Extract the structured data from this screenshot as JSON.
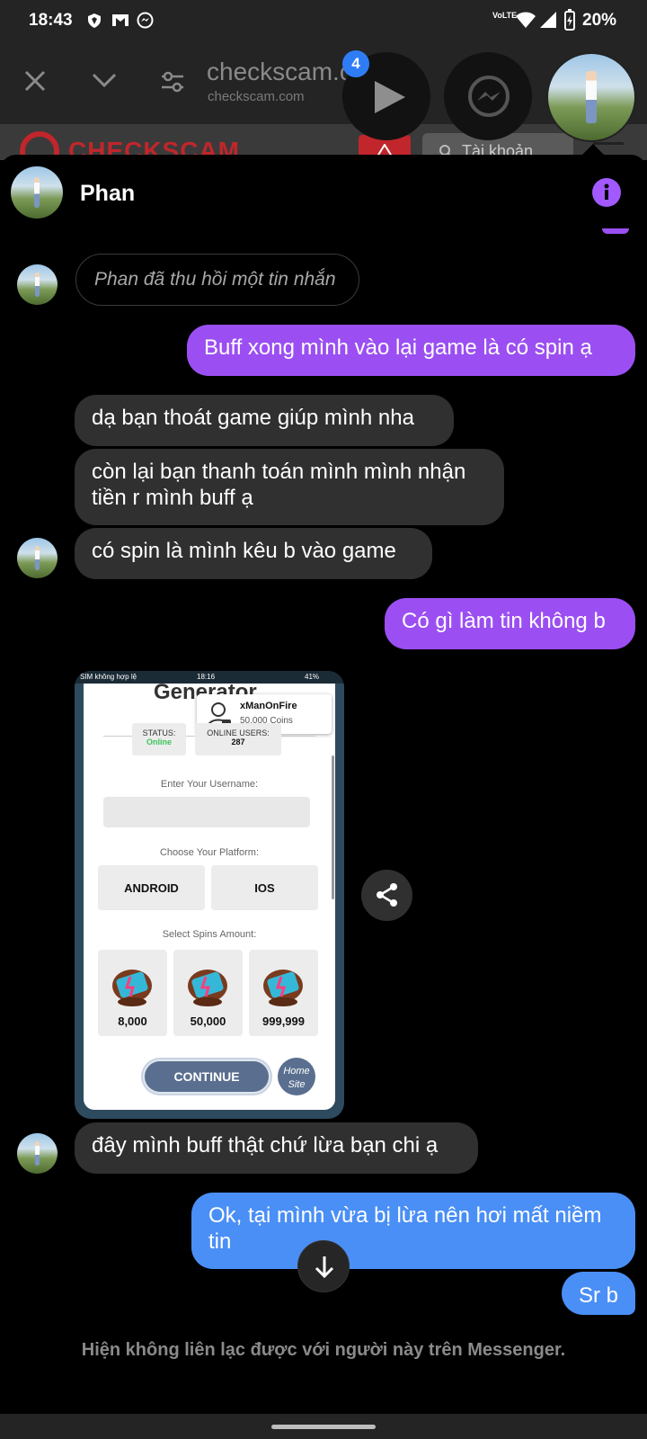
{
  "status_bar": {
    "time": "18:43",
    "network_label": "VoLTE",
    "battery": "20%",
    "icons": [
      "shield-icon",
      "gmail-icon",
      "messenger-icon",
      "wifi-icon",
      "signal-icon",
      "battery-icon"
    ]
  },
  "browser": {
    "title": "checkscam.c",
    "url": "checkscam.com",
    "chat_head_badge": "4"
  },
  "site_peek": {
    "logo_text": "CHECKSCAM",
    "account_button": "Tài khoản"
  },
  "chat": {
    "contact_name": "Phan",
    "unsent_notice": "Phan đã thu hồi một tin nhắn",
    "messages": [
      {
        "from": "me",
        "text": "Buff xong mình vào lại game là có spin ạ"
      },
      {
        "from": "them",
        "text": "dạ bạn thoát game giúp mình nha"
      },
      {
        "from": "them",
        "text": "còn lại bạn thanh toán mình mình nhận tiền r mình buff ạ"
      },
      {
        "from": "them",
        "text": "có spin là mình kêu b vào game"
      },
      {
        "from": "me",
        "text": "Có gì làm tin không b"
      },
      {
        "from": "them",
        "text": "đây mình buff thật chứ lừa bạn chi ạ"
      },
      {
        "from": "me",
        "text": "Ok, tại mình vừa bị lừa nên hơi mất niềm tin"
      },
      {
        "from": "me",
        "text": "Sr b"
      }
    ],
    "footer_notice": "Hiện không liên lạc được với người này trên Messenger."
  },
  "screenshot": {
    "status_carrier": "SIM không hợp lệ",
    "status_time": "18:16",
    "status_battery": "41%",
    "header_title": "Generator",
    "toast_user": "xManOnFire",
    "toast_coins": "50,000 Coins",
    "status_label": "STATUS:",
    "status_value": "Online",
    "online_users_label": "ONLINE USERS:",
    "online_users_value": "287",
    "username_label": "Enter Your Username:",
    "platform_label": "Choose Your Platform:",
    "platforms": [
      "ANDROID",
      "IOS"
    ],
    "spins_label": "Select Spins Amount:",
    "spin_amounts": [
      "8,000",
      "50,000",
      "999,999"
    ],
    "continue_button": "CONTINUE",
    "home_site_line1": "Home",
    "home_site_line2": "Site"
  },
  "colors": {
    "outgoing_bubble": "#9b4ff2",
    "outgoing_bubble_latest": "#4a8ff6",
    "incoming_bubble": "#303030",
    "accent": "#a259ff",
    "status_online": "#3cc45a",
    "continue_button": "#5a6f8f"
  }
}
